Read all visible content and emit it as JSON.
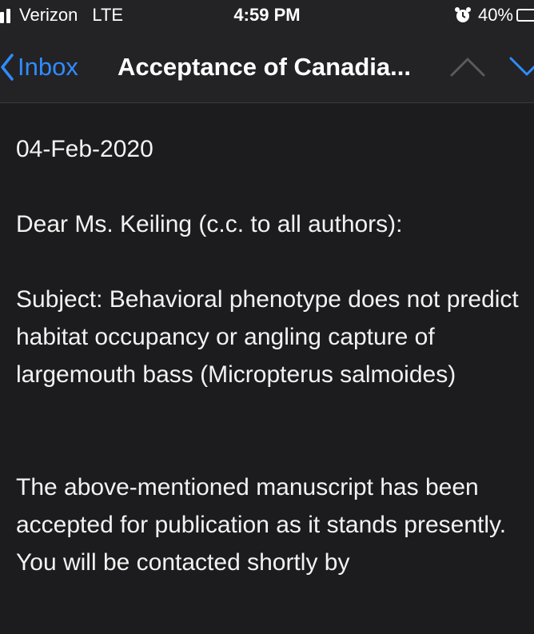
{
  "status_bar": {
    "carrier": "Verizon",
    "network": "LTE",
    "time": "4:59 PM",
    "battery": "40%"
  },
  "nav": {
    "back_label": "Inbox",
    "title": "Acceptance of Canadia...",
    "accent_color": "#2f8cff"
  },
  "email": {
    "date": "04-Feb-2020",
    "greeting": "Dear Ms. Keiling (c.c. to all authors):",
    "subject": "Subject:  Behavioral phenotype does not predict habitat occupancy or angling capture of largemouth bass (Micropterus salmoides)",
    "body": "The above-mentioned manuscript has been accepted for publication as it stands presently. You will be contacted shortly by"
  }
}
